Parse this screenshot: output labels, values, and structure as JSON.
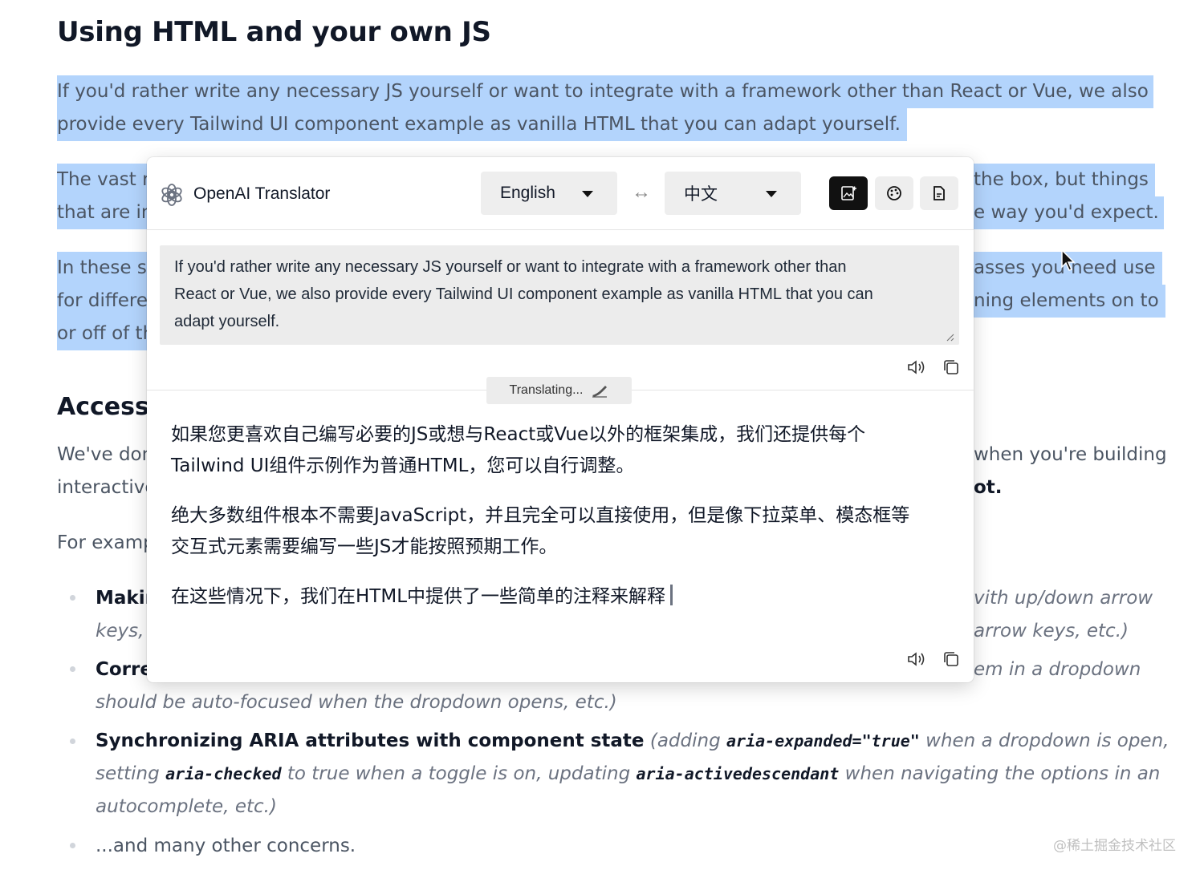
{
  "article": {
    "heading": "Using HTML and your own JS",
    "para1_line1": "If you'd rather write any necessary JS yourself or want to integrate with a framework other than React or Vue, we also",
    "para1_line2": "provide every Tailwind UI component example as vanilla HTML that you can adapt yourself.",
    "para2_left1": "The vast r",
    "para2_left2": "that are in",
    "para2_right1": "the box, but things",
    "para2_right2": "e way you'd expect.",
    "para3_left1": "In these s",
    "para3_left2": "for differe",
    "para3_left3": "or off of th",
    "para3_right1": "asses you need use",
    "para3_right2": "ning elements on to",
    "section_heading": "Access",
    "para4_left1": "We've don",
    "para4_left2": "interactive",
    "para4_right1": "when you're building",
    "para4_right2": "ot.",
    "para5_left": "For examp",
    "list1_left_strong": "Makin",
    "list1_left2": "keys,",
    "list1_right1": "vith up/down arrow",
    "list1_right2": "arrow keys, etc.)",
    "list2_left_strong": "Corre",
    "list2_right1": "em in a dropdown",
    "list2_line2": "should be auto-focused when the dropdown opens, etc.)",
    "list3_strong": "Synchronizing ARIA attributes with component state",
    "list3_a": " (adding ",
    "list3_code1": "aria-expanded=\"true\"",
    "list3_b": " when a dropdown is open,",
    "list3_c": "setting ",
    "list3_code2": "aria-checked",
    "list3_d": " to true when a toggle is on, updating ",
    "list3_code3": "aria-activedescendant",
    "list3_e": " when navigating the options in an",
    "list3_f": "autocomplete, etc.)",
    "list4": "...and many other concerns.",
    "watermark": "@稀土掘金技术社区"
  },
  "translator": {
    "title": "OpenAI Translator",
    "source_lang": "English",
    "target_lang": "中文",
    "swap_symbol": "↔",
    "source_text_line1": "If you'd rather write any necessary JS yourself or want to integrate with a framework other than",
    "source_text_line2": "React or Vue, we also provide every Tailwind UI component example as vanilla HTML that you can",
    "source_text_line3": "adapt yourself.",
    "status": "Translating...",
    "output_p1_line1": "如果您更喜欢自己编写必要的JS或想与React或Vue以外的框架集成，我们还提供每个",
    "output_p1_line2": "Tailwind UI组件示例作为普通HTML，您可以自行调整。",
    "output_p2_line1": "绝大多数组件根本不需要JavaScript，并且完全可以直接使用，但是像下拉菜单、模态框等",
    "output_p2_line2": "交互式元素需要编写一些JS才能按照预期工作。",
    "output_p3_line1": "在这些情况下，我们在HTML中提供了一些简单的注释来解释"
  },
  "colors": {
    "selection": "#b3d4fc",
    "heading": "#111827",
    "body_text": "#4b5563",
    "dark_button": "#111111"
  }
}
